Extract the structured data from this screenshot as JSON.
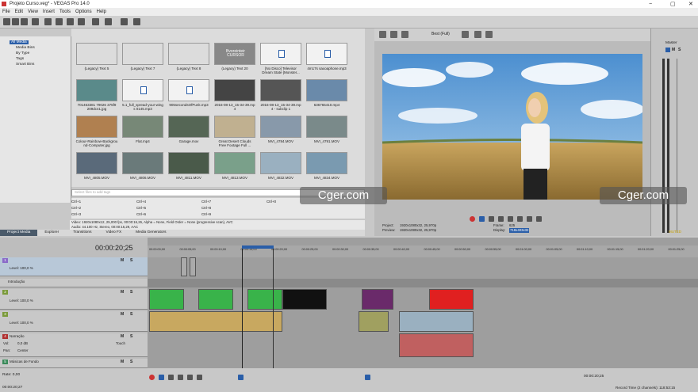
{
  "window": {
    "title": "Projeto Curso.veg* - VEGAS Pro 14.0"
  },
  "menu": [
    "File",
    "Edit",
    "View",
    "Insert",
    "Tools",
    "Options",
    "Help"
  ],
  "explorer": {
    "items": [
      "All Media",
      "Media Bins",
      "By Type",
      "Tags",
      "Smart Bins"
    ]
  },
  "media": {
    "items": [
      {
        "caption": "(Legacy) Text 5",
        "color": "#dcdcdc"
      },
      {
        "caption": "(Legacy) Text 7",
        "color": "#dcdcdc"
      },
      {
        "caption": "(Legacy) Text 8",
        "color": "#dcdcdc"
      },
      {
        "caption": "(Legacy) Text 20",
        "color": "#888888",
        "overlay": "Bvoreinteir\nCURSOR"
      },
      {
        "caption": "[No Disco] Televisor\nDream State [Monster...",
        "color": "#f2f2f2",
        "icon": "file-icon"
      },
      {
        "caption": "4m17s saxoaphone.mp3",
        "color": "#f2f2f2",
        "icon": "file-icon"
      },
      {
        "caption": "701463381 79026 375f9\n209dc41.jpg",
        "color": "#5a8a8a"
      },
      {
        "caption": "5.1_full_spread-your-wing\ns 0145.mp3",
        "color": "#f2f2f2",
        "icon": "file-icon"
      },
      {
        "caption": "905secondsOfPunk.mp3",
        "color": "#f2f2f2",
        "icon": "file-icon"
      },
      {
        "caption": "2016-08-13_15-34-39.mp\n4",
        "color": "#444444"
      },
      {
        "caption": "2016-08-13_15-34-39.mp\n4 - subclip 1",
        "color": "#555555"
      },
      {
        "caption": "636765410.mp4",
        "color": "#6a8aaa"
      },
      {
        "caption": "Colour-Rainbow-Backgrou\nnd-Computer.jpg",
        "color": "#b08050"
      },
      {
        "caption": "Flat.mp4",
        "color": "#778877"
      },
      {
        "caption": "Garage.mov",
        "color": "#556655"
      },
      {
        "caption": "Great Desert Clouds\nFree Footage   Full ...",
        "color": "#c0b090"
      },
      {
        "caption": "MVI_4784.MOV",
        "color": "#8899aa"
      },
      {
        "caption": "MVI_4791.MOV",
        "color": "#7a8a8a"
      },
      {
        "caption": "MVI_4805.MOV",
        "color": "#5a6a7a"
      },
      {
        "caption": "MVI_4806.MOV",
        "color": "#6a7a7a"
      },
      {
        "caption": "MVI_4811.MOV",
        "color": "#4a5a4a"
      },
      {
        "caption": "MVI_4813.MOV",
        "color": "#7aa08a"
      },
      {
        "caption": "MVI_4832.MOV",
        "color": "#9ab0c0"
      },
      {
        "caption": "MVI_4834.MOV",
        "color": "#7a9ab0"
      }
    ],
    "filter_placeholder": "Select files to add tags",
    "shortcuts": [
      "Ctrl+1",
      "Ctrl+2",
      "Ctrl+3",
      "Ctrl+4",
      "Ctrl+5",
      "Ctrl+6",
      "Ctrl+7",
      "Ctrl+8",
      "Ctrl+9",
      "Ctrl+0"
    ],
    "info_line1": "Video: 1920x1080x12, 25,000 fps, 00:00:16,26, Alpha = None, Field Order = None (progressive scan), AVC",
    "info_line2": "Audio: 44.100 Hz, Stereo, 00:00:16,29, AAC"
  },
  "tabs": [
    "Project Media",
    "Explorer",
    "Transitions",
    "Video FX",
    "Media Generators"
  ],
  "preview": {
    "quality": "Best (Full)",
    "project_label": "Project:",
    "project_value": "1920x1080x32, 25,970p",
    "preview_label": "Preview:",
    "preview_value": "1920x1080x32, 25,970p",
    "frame_label": "Frame:",
    "frame_value": "625",
    "display_label": "Display:",
    "display_value": "718x403x32"
  },
  "watermarks": [
    "Cger.com",
    "Cger.com"
  ],
  "mixer": {
    "label": "Master",
    "muted": "MUTED"
  },
  "timeline": {
    "timecode": "00:00:20;25",
    "ruler": [
      "00:00:00;00",
      "00:00:05;00",
      "00:00:10;00",
      "00:00:15;00",
      "00:00:20;00",
      "00:00:25;00",
      "00:00:30;00",
      "00:00:35;00",
      "00:00:40;00",
      "00:00:45;00",
      "00:00:50;00",
      "00:00:55;00",
      "00:01:00;00",
      "00:01:05;00",
      "00:01:10;00",
      "00:01:15;00",
      "00:01:20;00",
      "00:01:25;00"
    ],
    "tracks": [
      {
        "num": "1",
        "name": "",
        "level": "Level: 100,0 %"
      },
      {
        "num": "",
        "name": "Introdução",
        "level": ""
      },
      {
        "num": "2",
        "name": "",
        "level": "Level: 100,0 %"
      },
      {
        "num": "3",
        "name": "",
        "level": "Level: 100,0 %"
      },
      {
        "num": "4",
        "name": "Narração",
        "vol": "Vol:",
        "vol_value": "0,0 dB",
        "pan": "Pan:",
        "pan_value": "Center",
        "touch": "Touch"
      },
      {
        "num": "5",
        "name": "Músicas de Fundo"
      }
    ],
    "rate": "Rate: 0,00",
    "footer_left": "00:00:20;27",
    "footer_time": "00:00:20;25",
    "record_time": "Record Time (2 channels): 118:53:15"
  },
  "colors": {
    "accent": "#3a4a5a",
    "green": "#39b34a",
    "red": "#e02020"
  }
}
